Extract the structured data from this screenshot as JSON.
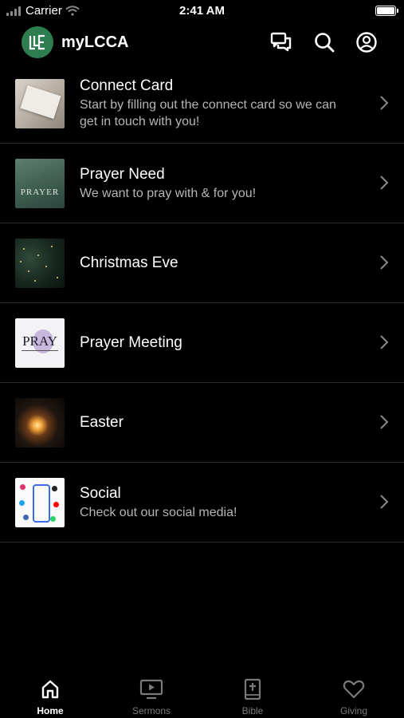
{
  "status_bar": {
    "carrier": "Carrier",
    "time": "2:41 AM"
  },
  "header": {
    "title": "myLCCA"
  },
  "items": [
    {
      "title": "Connect Card",
      "subtitle": "Start by filling out the connect card so we can get in touch with you!"
    },
    {
      "title": "Prayer Need",
      "subtitle": "We want to pray with & for you!"
    },
    {
      "title": "Christmas Eve",
      "subtitle": ""
    },
    {
      "title": "Prayer Meeting",
      "subtitle": ""
    },
    {
      "title": "Easter",
      "subtitle": ""
    },
    {
      "title": "Social",
      "subtitle": "Check out our social media!"
    }
  ],
  "thumb_text": {
    "prayer": "PRAYER",
    "pray": "PRAY"
  },
  "tabs": [
    {
      "label": "Home",
      "icon": "home-icon"
    },
    {
      "label": "Sermons",
      "icon": "sermons-icon"
    },
    {
      "label": "Bible",
      "icon": "bible-icon"
    },
    {
      "label": "Giving",
      "icon": "heart-icon"
    }
  ],
  "colors": {
    "background": "#000000",
    "brand": "#2e7d4f",
    "divider": "#2a2a2a",
    "subtitle": "#b5b5b5",
    "inactive_tab": "#7a7a7a"
  }
}
